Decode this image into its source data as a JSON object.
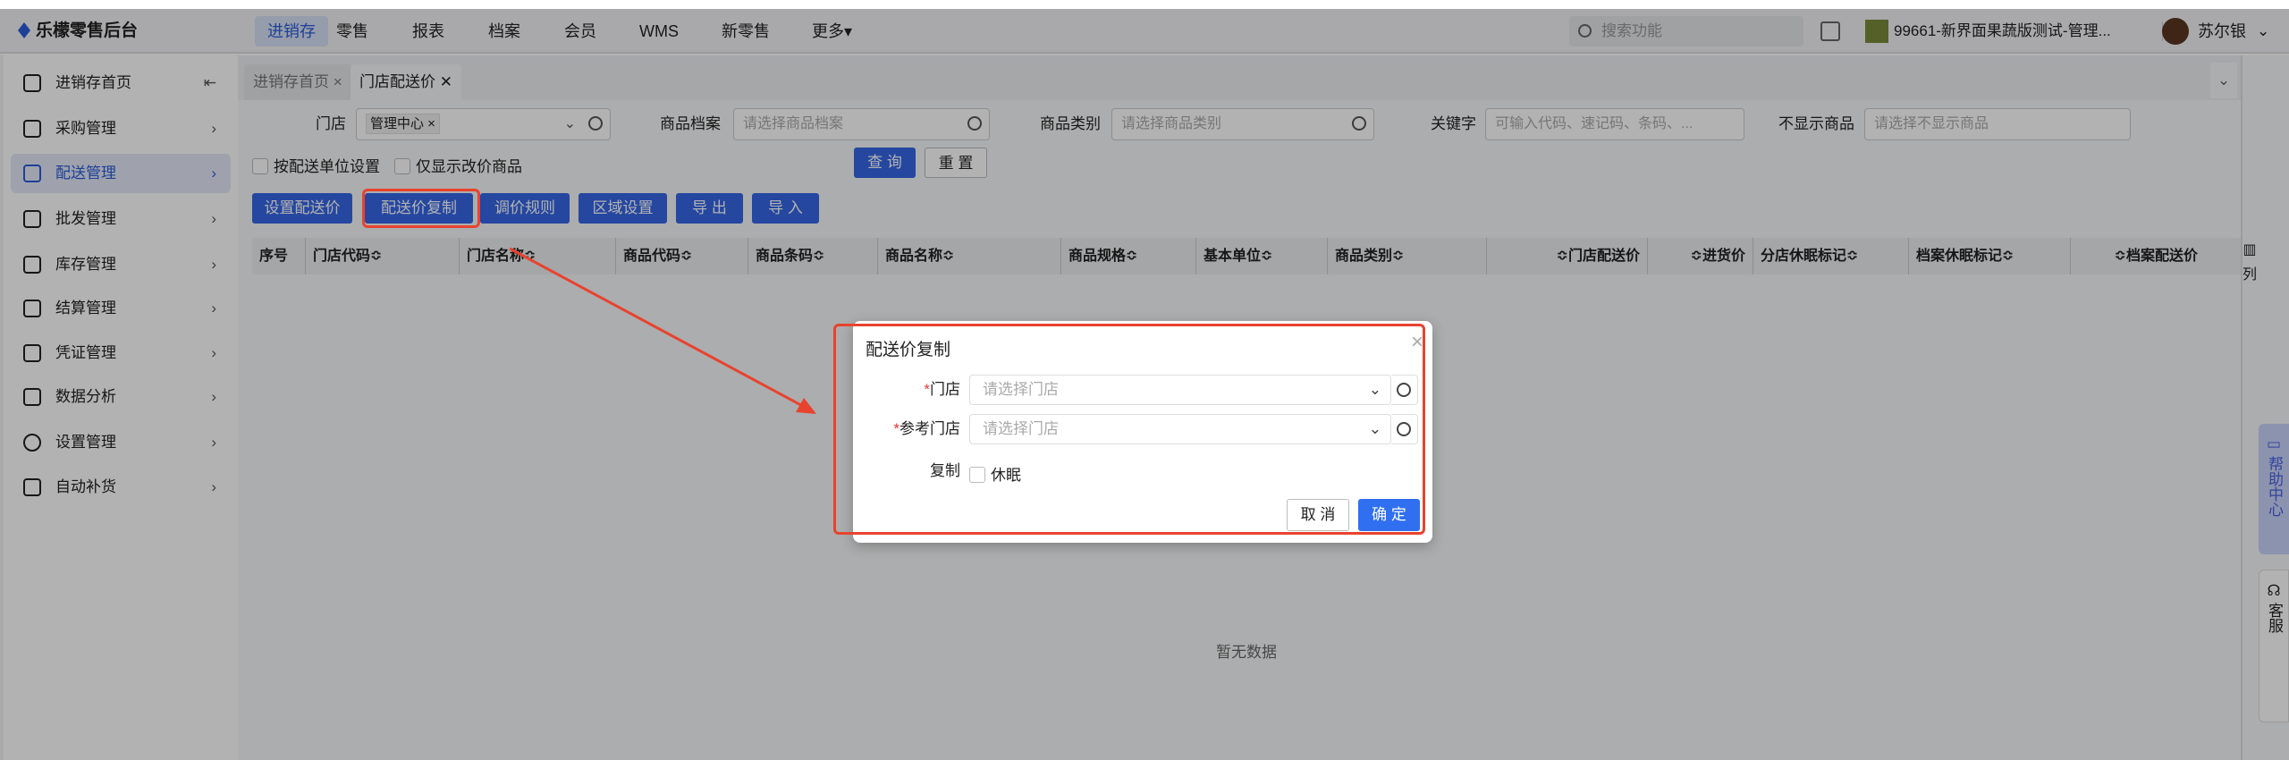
{
  "app": {
    "logo": "乐檬零售后台"
  },
  "topnav": {
    "items": [
      "进销存",
      "零售",
      "报表",
      "档案",
      "会员",
      "WMS",
      "新零售",
      "更多▾"
    ],
    "search_placeholder": "搜索功能",
    "store": "99661-新界面果蔬版测试-管理...",
    "user": "苏尔银"
  },
  "sidebar": {
    "items": [
      "进销存首页",
      "采购管理",
      "配送管理",
      "批发管理",
      "库存管理",
      "结算管理",
      "凭证管理",
      "数据分析",
      "设置管理",
      "自动补货"
    ]
  },
  "tabs": [
    {
      "label": "进销存首页 ×"
    },
    {
      "label": "门店配送价 ✕"
    }
  ],
  "filters": {
    "store_label": "门店",
    "store_tag": "管理中心 ×",
    "archive_label": "商品档案",
    "archive_placeholder": "请选择商品档案",
    "category_label": "商品类别",
    "category_placeholder": "请选择商品类别",
    "keyword_label": "关键字",
    "keyword_placeholder": "可输入代码、速记码、条码、...",
    "hide_label": "不显示商品",
    "hide_placeholder": "请选择不显示商品",
    "cb1": "按配送单位设置",
    "cb2": "仅显示改价商品",
    "query": "查 询",
    "reset": "重 置"
  },
  "toolbar": [
    "设置配送价",
    "配送价复制",
    "调价规则",
    "区域设置",
    "导 出",
    "导 入"
  ],
  "table": {
    "columns": [
      "序号",
      "门店代码≎",
      "门店名称≎",
      "商品代码≎",
      "商品条码≎",
      "商品名称≎",
      "商品规格≎",
      "基本单位≎",
      "商品类别≎",
      "≎门店配送价",
      "≎进货价",
      "分店休眠标记≎",
      "档案休眠标记≎",
      "≎档案配送价"
    ],
    "empty": "暂无数据",
    "col_setting": "列"
  },
  "modal": {
    "title": "配送价复制",
    "store_label": "门店",
    "ref_store_label": "参考门店",
    "placeholder": "请选择门店",
    "copy_label": "复制",
    "copy_option": "休眠",
    "cancel": "取 消",
    "ok": "确 定"
  },
  "floating": {
    "help": "帮助中心",
    "service": "客服"
  }
}
